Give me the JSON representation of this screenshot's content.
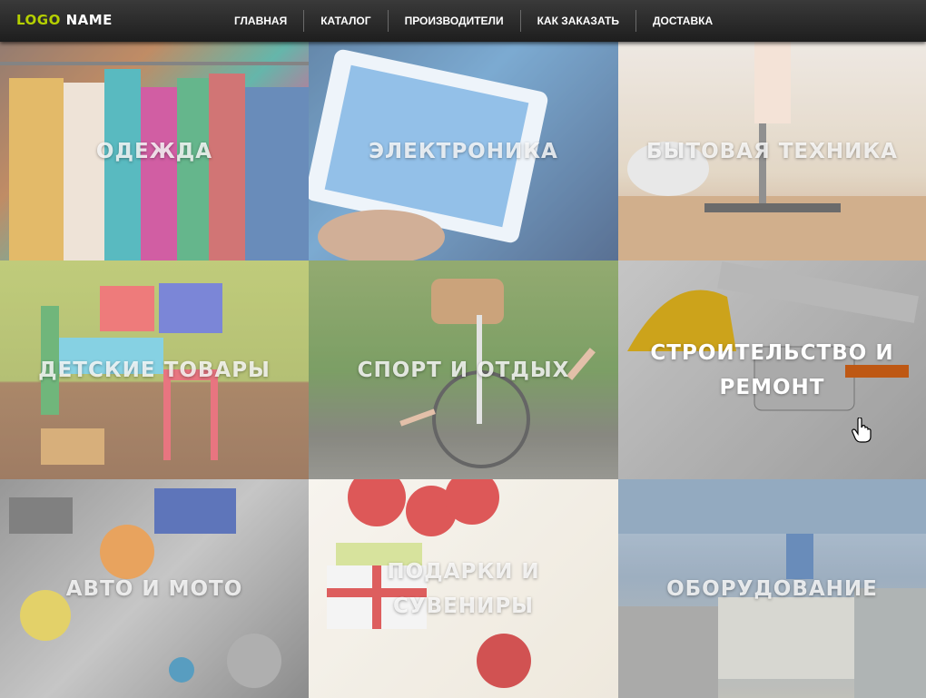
{
  "header": {
    "logo_part1": "LOGO",
    "logo_part2": "NAME",
    "nav": [
      "ГЛАВНАЯ",
      "КАТАЛОГ",
      "ПРОИЗВОДИТЕЛИ",
      "КАК ЗАКАЗАТЬ",
      "ДОСТАВКА"
    ]
  },
  "categories": [
    {
      "lines": [
        "ОДЕЖДА"
      ]
    },
    {
      "lines": [
        "ЭЛЕКТРОНИКА"
      ]
    },
    {
      "lines": [
        "БЫТОВАЯ ТЕХНИКА"
      ]
    },
    {
      "lines": [
        "ДЕТСКИЕ ТОВАРЫ"
      ]
    },
    {
      "lines": [
        "СПОРТ И ОТДЫХ"
      ]
    },
    {
      "lines": [
        "СТРОИТЕЛЬСТВО И",
        "РЕМОНТ"
      ]
    },
    {
      "lines": [
        "АВТО И МОТО"
      ]
    },
    {
      "lines": [
        "ПОДАРКИ И",
        "СУВЕНИРЫ"
      ]
    },
    {
      "lines": [
        "ОБОРУДОВАНИЕ"
      ]
    }
  ],
  "colors": {
    "logo_accent": "#b5d000",
    "header_bg": "#2c2c2c"
  },
  "icons": [
    "hand-cursor-icon"
  ]
}
